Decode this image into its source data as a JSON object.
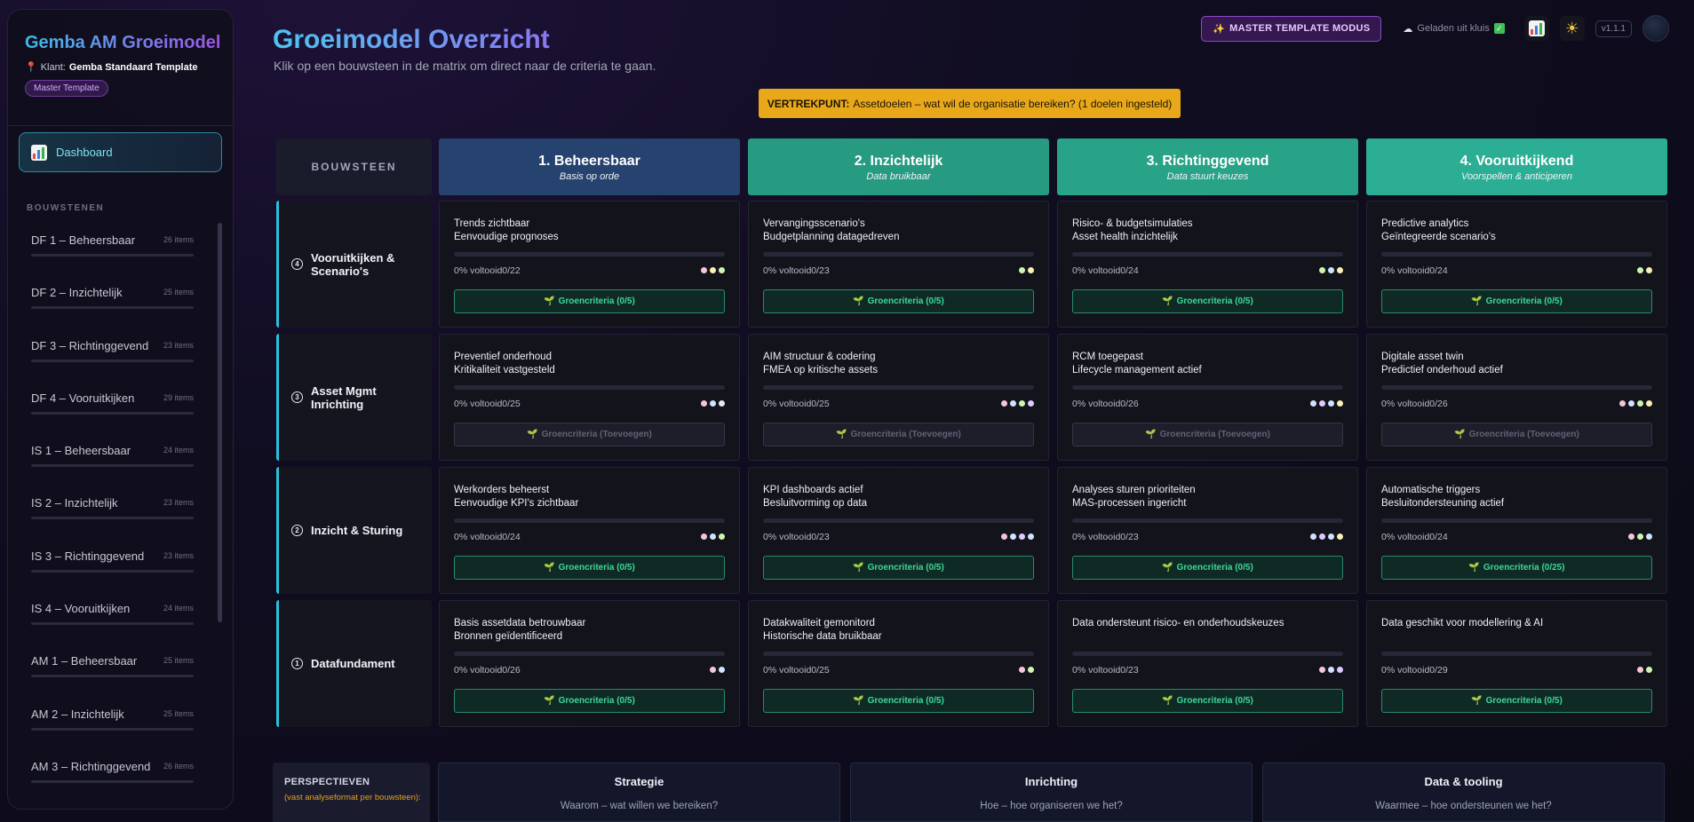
{
  "sidebar": {
    "title": "Gemba AM Groeimodel",
    "client_prefix": "Klant:",
    "client_name": "Gemba Standaard Template",
    "template_badge": "Master Template",
    "dashboard_label": "Dashboard",
    "section_label": "BOUWSTENEN",
    "items": [
      {
        "name": "DF 1 – Beheersbaar",
        "count": "26 items"
      },
      {
        "name": "DF 2 – Inzichtelijk",
        "count": "25 items"
      },
      {
        "name": "DF 3 – Richtinggevend",
        "count": "23 items"
      },
      {
        "name": "DF 4 – Vooruitkijken",
        "count": "29 items"
      },
      {
        "name": "IS 1 – Beheersbaar",
        "count": "24 items"
      },
      {
        "name": "IS 2 – Inzichtelijk",
        "count": "23 items"
      },
      {
        "name": "IS 3 – Richtinggevend",
        "count": "23 items"
      },
      {
        "name": "IS 4 – Vooruitkijken",
        "count": "24 items"
      },
      {
        "name": "AM 1 – Beheersbaar",
        "count": "25 items"
      },
      {
        "name": "AM 2 – Inzichtelijk",
        "count": "25 items"
      },
      {
        "name": "AM 3 – Richtinggevend",
        "count": "26 items"
      }
    ]
  },
  "header": {
    "title": "Groeimodel Overzicht",
    "subtitle": "Klik op een bouwsteen in de matrix om direct naar de criteria te gaan.",
    "master_mode_label": "MASTER TEMPLATE MODUS",
    "loaded_status": "Geladen uit kluis",
    "version": "v1.1.1"
  },
  "banner": {
    "label": "VERTREKPUNT:",
    "text": "Assetdoelen – wat wil de organisatie bereiken? (1 doelen ingesteld)"
  },
  "matrix": {
    "corner_label": "BOUWSTEEN",
    "columns": [
      {
        "title": "1. Beheersbaar",
        "subtitle": "Basis op orde",
        "color": "#26436f"
      },
      {
        "title": "2. Inzichtelijk",
        "subtitle": "Data bruikbaar",
        "color": "#279a82"
      },
      {
        "title": "3. Richtinggevend",
        "subtitle": "Data stuurt keuzes",
        "color": "#29a388"
      },
      {
        "title": "4. Vooruitkijkend",
        "subtitle": "Voorspellen & anticiperen",
        "color": "#2cae94"
      }
    ],
    "rows": [
      {
        "num": "4",
        "title": "Vooruitkijken & Scenario's",
        "cells": [
          {
            "l1": "Trends zichtbaar",
            "l2": "Eenvoudige prognoses",
            "progress": "0% voltooid",
            "count": "0/22",
            "dots": [
              "#f7c6d6",
              "#fbf0b4",
              "#cdf5b0"
            ],
            "criteria": "Groencriteria (0/5)",
            "state": "green"
          },
          {
            "l1": "Vervangingsscenario's",
            "l2": "Budgetplanning datagedreven",
            "progress": "0% voltooid",
            "count": "0/23",
            "dots": [
              "#cdf5b0",
              "#fbf0b4"
            ],
            "criteria": "Groencriteria (0/5)",
            "state": "green"
          },
          {
            "l1": "Risico- & budgetsimulaties",
            "l2": "Asset health inzichtelijk",
            "progress": "0% voltooid",
            "count": "0/24",
            "dots": [
              "#cdf5b0",
              "#cfe3ff",
              "#fbf0b4"
            ],
            "criteria": "Groencriteria (0/5)",
            "state": "green"
          },
          {
            "l1": "Predictive analytics",
            "l2": "Geïntegreerde scenario's",
            "progress": "0% voltooid",
            "count": "0/24",
            "dots": [
              "#cdf5b0",
              "#fbf0b4"
            ],
            "criteria": "Groencriteria (0/5)",
            "state": "green"
          }
        ]
      },
      {
        "num": "3",
        "title": "Asset Mgmt Inrichting",
        "cells": [
          {
            "l1": "Preventief onderhoud",
            "l2": "Kritikaliteit vastgesteld",
            "progress": "0% voltooid",
            "count": "0/25",
            "dots": [
              "#f7c6d6",
              "#cfe3ff",
              "#e7e7ef"
            ],
            "criteria": "Groencriteria (Toevoegen)",
            "state": "grey"
          },
          {
            "l1": "AIM structuur & codering",
            "l2": "FMEA op kritische assets",
            "progress": "0% voltooid",
            "count": "0/25",
            "dots": [
              "#f7c6d6",
              "#cfe3ff",
              "#cdf5b0",
              "#dccbff"
            ],
            "criteria": "Groencriteria (Toevoegen)",
            "state": "grey"
          },
          {
            "l1": "RCM toegepast",
            "l2": "Lifecycle management actief",
            "progress": "0% voltooid",
            "count": "0/26",
            "dots": [
              "#cfe3ff",
              "#dccbff",
              "#cfe3ff",
              "#fbf0b4"
            ],
            "criteria": "Groencriteria (Toevoegen)",
            "state": "grey"
          },
          {
            "l1": "Digitale asset twin",
            "l2": "Predictief onderhoud actief",
            "progress": "0% voltooid",
            "count": "0/26",
            "dots": [
              "#f7c6d6",
              "#cfe3ff",
              "#cdf5b0",
              "#fbf0b4"
            ],
            "criteria": "Groencriteria (Toevoegen)",
            "state": "grey"
          }
        ]
      },
      {
        "num": "2",
        "title": "Inzicht & Sturing",
        "cells": [
          {
            "l1": "Werkorders beheerst",
            "l2": "Eenvoudige KPI's zichtbaar",
            "progress": "0% voltooid",
            "count": "0/24",
            "dots": [
              "#f7c6d6",
              "#cfe3ff",
              "#cdf5b0"
            ],
            "criteria": "Groencriteria (0/5)",
            "state": "green"
          },
          {
            "l1": "KPI dashboards actief",
            "l2": "Besluitvorming op data",
            "progress": "0% voltooid",
            "count": "0/23",
            "dots": [
              "#f7c6d6",
              "#cfe3ff",
              "#dccbff",
              "#cfe3ff"
            ],
            "criteria": "Groencriteria (0/5)",
            "state": "green"
          },
          {
            "l1": "Analyses sturen prioriteiten",
            "l2": "MAS-processen ingericht",
            "progress": "0% voltooid",
            "count": "0/23",
            "dots": [
              "#cfe3ff",
              "#dccbff",
              "#cfe3ff",
              "#fbf0b4"
            ],
            "criteria": "Groencriteria (0/5)",
            "state": "green"
          },
          {
            "l1": "Automatische triggers",
            "l2": "Besluitondersteuning actief",
            "progress": "0% voltooid",
            "count": "0/24",
            "dots": [
              "#f7c6d6",
              "#cdf5b0",
              "#cfe3ff"
            ],
            "criteria": "Groencriteria (0/25)",
            "state": "green"
          }
        ]
      },
      {
        "num": "1",
        "title": "Datafundament",
        "cells": [
          {
            "l1": "Basis assetdata betrouwbaar",
            "l2": "Bronnen geïdentificeerd",
            "progress": "0% voltooid",
            "count": "0/26",
            "dots": [
              "#f7c6d6",
              "#cfe3ff"
            ],
            "criteria": "Groencriteria (0/5)",
            "state": "green"
          },
          {
            "l1": "Datakwaliteit gemonitord",
            "l2": "Historische data bruikbaar",
            "progress": "0% voltooid",
            "count": "0/25",
            "dots": [
              "#f7c6d6",
              "#cdf5b0"
            ],
            "criteria": "Groencriteria (0/5)",
            "state": "green"
          },
          {
            "l1": "Data ondersteunt risico- en onderhoudskeuzes",
            "l2": "",
            "progress": "0% voltooid",
            "count": "0/23",
            "dots": [
              "#f7c6d6",
              "#cfe3ff",
              "#dccbff"
            ],
            "criteria": "Groencriteria (0/5)",
            "state": "green"
          },
          {
            "l1": "Data geschikt voor modellering & AI",
            "l2": "",
            "progress": "0% voltooid",
            "count": "0/29",
            "dots": [
              "#f7c6d6",
              "#cdf5b0"
            ],
            "criteria": "Groencriteria (0/5)",
            "state": "green"
          }
        ]
      }
    ]
  },
  "perspectives": {
    "label": "PERSPECTIEVEN",
    "sublabel": "(vast analyseformat per bouwsteen):",
    "cards": [
      {
        "title": "Strategie",
        "subtitle": "Waarom – wat willen we bereiken?"
      },
      {
        "title": "Inrichting",
        "subtitle": "Hoe – hoe organiseren we het?"
      },
      {
        "title": "Data & tooling",
        "subtitle": "Waarmee – hoe ondersteunen we het?"
      }
    ]
  },
  "icons": {
    "pin": "pin-icon",
    "dashboard": "chart-icon",
    "sparkle": "sparkle-icon",
    "cloud": "cloud-icon",
    "check": "check-icon",
    "sun": "sun-icon",
    "sprout": "sprout-icon"
  }
}
